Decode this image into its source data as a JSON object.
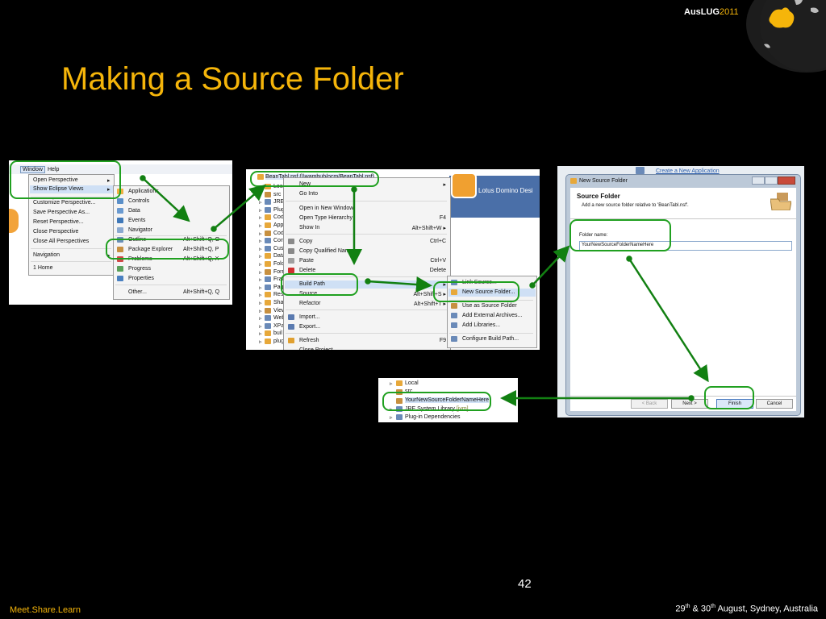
{
  "slide": {
    "title": "Making a Source Folder",
    "brand_prefix": "AusLUG",
    "brand_year": "2011",
    "page_number": "42",
    "footer_left": "Meet.Share.Learn",
    "footer_right_day1": "29",
    "footer_right_suffix1": "th",
    "footer_right_amp": " & 30",
    "footer_right_suffix2": "th",
    "footer_right_rest": " August, Sydney, Australia"
  },
  "colors": {
    "accent": "#f5b50a",
    "callout": "#20a020",
    "arrow": "#128012"
  },
  "shot1": {
    "menubar": [
      "Window",
      "Help"
    ],
    "window_menu": [
      "Open Perspective",
      "Show Eclipse Views",
      "Customize Perspective...",
      "Save Perspective As...",
      "Reset Perspective...",
      "Close Perspective",
      "Close All Perspectives",
      "Navigation",
      "1 Home"
    ],
    "views_menu": [
      {
        "label": "Applications",
        "shortcut": ""
      },
      {
        "label": "Controls",
        "shortcut": ""
      },
      {
        "label": "Data",
        "shortcut": ""
      },
      {
        "label": "Events",
        "shortcut": ""
      },
      {
        "label": "Navigator",
        "shortcut": ""
      },
      {
        "label": "Outline",
        "shortcut": "Alt+Shift+Q, O"
      },
      {
        "label": "Package Explorer",
        "shortcut": "Alt+Shift+Q, P"
      },
      {
        "label": "Problems",
        "shortcut": "Alt+Shift+Q, X"
      },
      {
        "label": "Progress",
        "shortcut": ""
      },
      {
        "label": "Properties",
        "shortcut": ""
      },
      {
        "label": "Other...",
        "shortcut": "Alt+Shift+Q, Q"
      }
    ]
  },
  "shot2": {
    "tree_root": "BeanTabl.nsf (\\\\wambuh/ocm/BeanTabl.nsf)",
    "tree": [
      "Local",
      "src",
      "JRE",
      "Plug",
      "Cod",
      "App",
      "Cod",
      "Con",
      "Cus",
      "Data",
      "Fold",
      "Form",
      "Fran",
      "Pag",
      "Reso",
      "Sha",
      "View",
      "Web",
      "XPa",
      "buil",
      "plug"
    ],
    "banner": "Lotus Domino Desi",
    "context_menu": [
      {
        "label": "New",
        "shortcut": "▸"
      },
      {
        "label": "Go Into",
        "shortcut": ""
      },
      {
        "label": "Open in New Window",
        "shortcut": ""
      },
      {
        "label": "Open Type Hierarchy",
        "shortcut": "F4"
      },
      {
        "label": "Show In",
        "shortcut": "Alt+Shift+W ▸"
      },
      {
        "label": "Copy",
        "shortcut": "Ctrl+C"
      },
      {
        "label": "Copy Qualified Name",
        "shortcut": ""
      },
      {
        "label": "Paste",
        "shortcut": "Ctrl+V"
      },
      {
        "label": "Delete",
        "shortcut": "Delete"
      },
      {
        "label": "Build Path",
        "shortcut": "▸"
      },
      {
        "label": "Source",
        "shortcut": "Alt+Shift+S ▸"
      },
      {
        "label": "Refactor",
        "shortcut": "Alt+Shift+T ▸"
      },
      {
        "label": "Import...",
        "shortcut": ""
      },
      {
        "label": "Export...",
        "shortcut": ""
      },
      {
        "label": "Refresh",
        "shortcut": "F9"
      },
      {
        "label": "Close Project",
        "shortcut": ""
      }
    ],
    "build_path_menu": [
      "Link Source...",
      "New Source Folder...",
      "Use as Source Folder",
      "Add External Archives...",
      "Add Libraries...",
      "Configure Build Path..."
    ]
  },
  "shot3": {
    "bg_link": "Create a New Application",
    "dialog_title": "New Source Folder",
    "heading": "Source Folder",
    "description": "Add a new source folder relative to 'BeanTabl.nsf'.",
    "field_label": "Folder name:",
    "field_value": "YourNewSourceFolderNameHere",
    "buttons": {
      "back": "< Back",
      "next": "Next >",
      "finish": "Finish",
      "cancel": "Cancel"
    }
  },
  "shot4": {
    "items": [
      "Local",
      "src",
      "YourNewSourceFolderNameHere",
      "JRE System Library",
      "Plug-in Dependencies"
    ],
    "jre_suffix": "[jvm]"
  }
}
